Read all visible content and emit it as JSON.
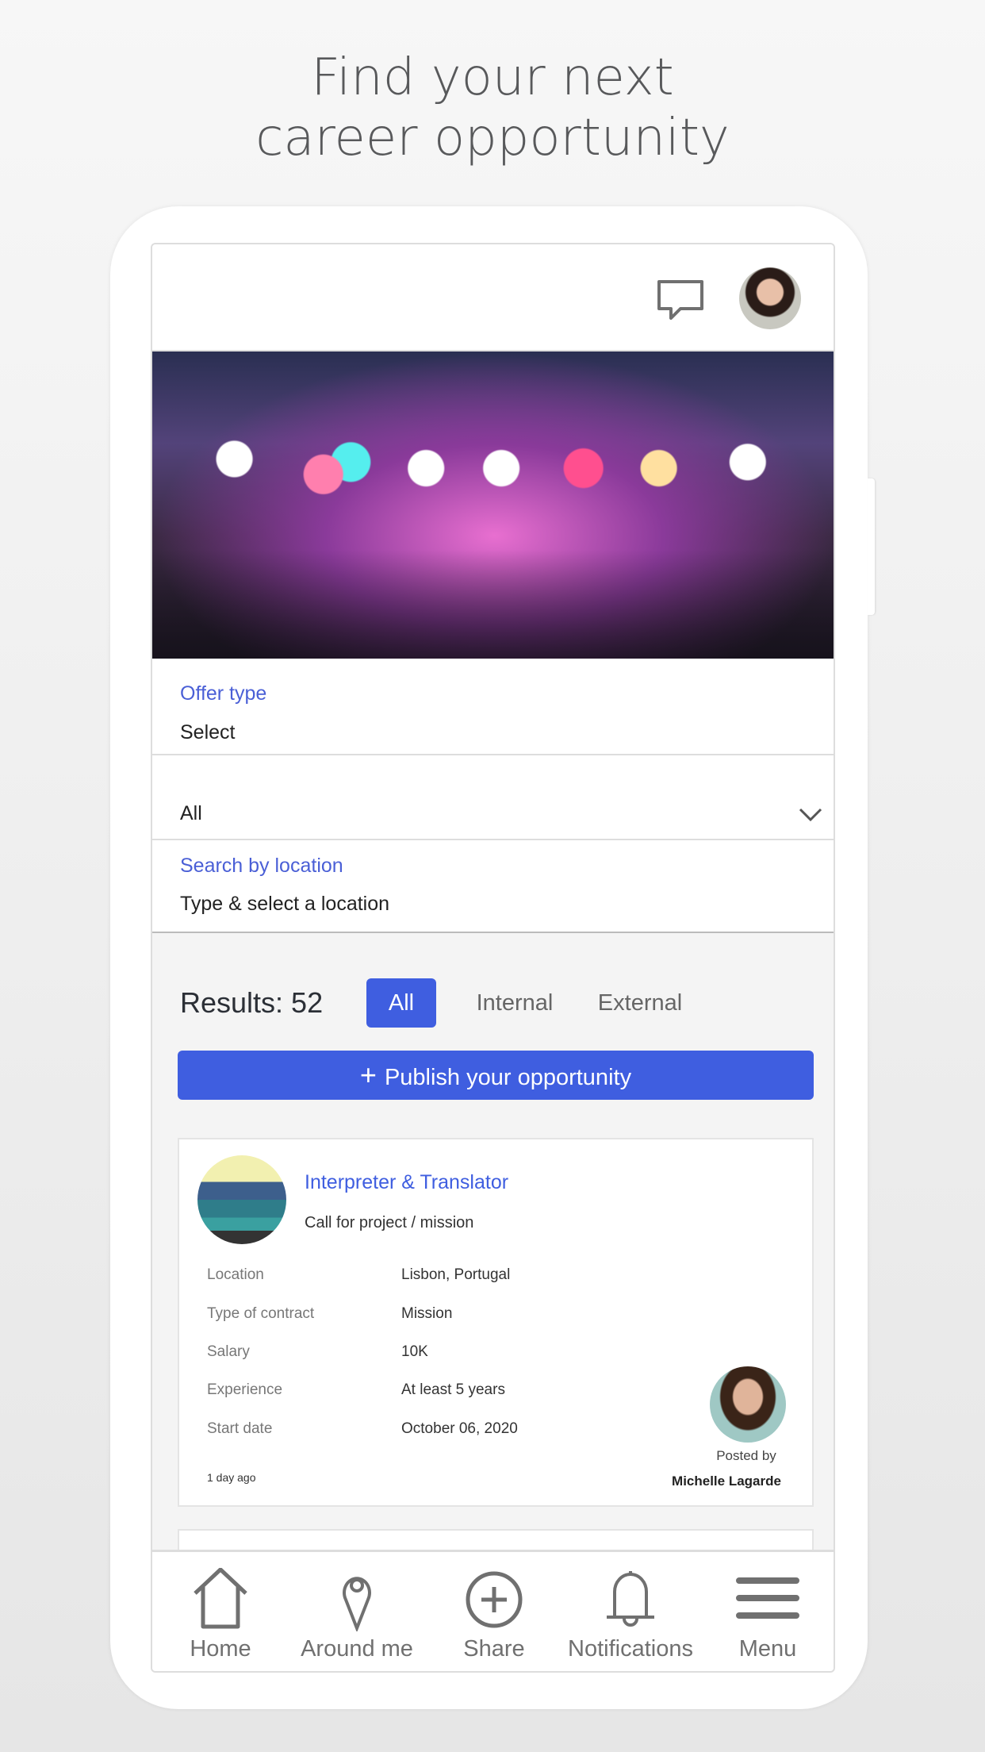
{
  "headline": {
    "line1": "Find your next",
    "line2": "career opportunity"
  },
  "colors": {
    "accent": "#3f5ee0",
    "label_blue": "#4a5fd6",
    "icon_gray": "#707070"
  },
  "header": {
    "icons": [
      "chat-icon",
      "user-avatar"
    ]
  },
  "filters": {
    "offer_type": {
      "label": "Offer type",
      "value": "Select"
    },
    "category": {
      "value": "All"
    },
    "location": {
      "label": "Search by location",
      "placeholder": "Type & select a location"
    }
  },
  "results": {
    "label": "Results: 52",
    "tabs": [
      "All",
      "Internal",
      "External"
    ],
    "active_tab": "All"
  },
  "publish_button": "Publish your opportunity",
  "card": {
    "title": "Interpreter & Translator",
    "subtitle": "Call for project / mission",
    "rows": [
      {
        "label": "Location",
        "value": "Lisbon, Portugal"
      },
      {
        "label": "Type of contract",
        "value": "Mission"
      },
      {
        "label": "Salary",
        "value": "10K"
      },
      {
        "label": "Experience",
        "value": "At least 5 years"
      },
      {
        "label": "Start date",
        "value": "October 06, 2020"
      }
    ],
    "posted_ago": "1 day ago",
    "posted_by_label": "Posted by",
    "posted_by_name": "Michelle Lagarde"
  },
  "nav": [
    {
      "label": "Home",
      "icon": "home-icon"
    },
    {
      "label": "Around me",
      "icon": "map-pin-icon"
    },
    {
      "label": "Share",
      "icon": "plus-circle-icon"
    },
    {
      "label": "Notifications",
      "icon": "bell-icon"
    },
    {
      "label": "Menu",
      "icon": "menu-icon"
    }
  ]
}
